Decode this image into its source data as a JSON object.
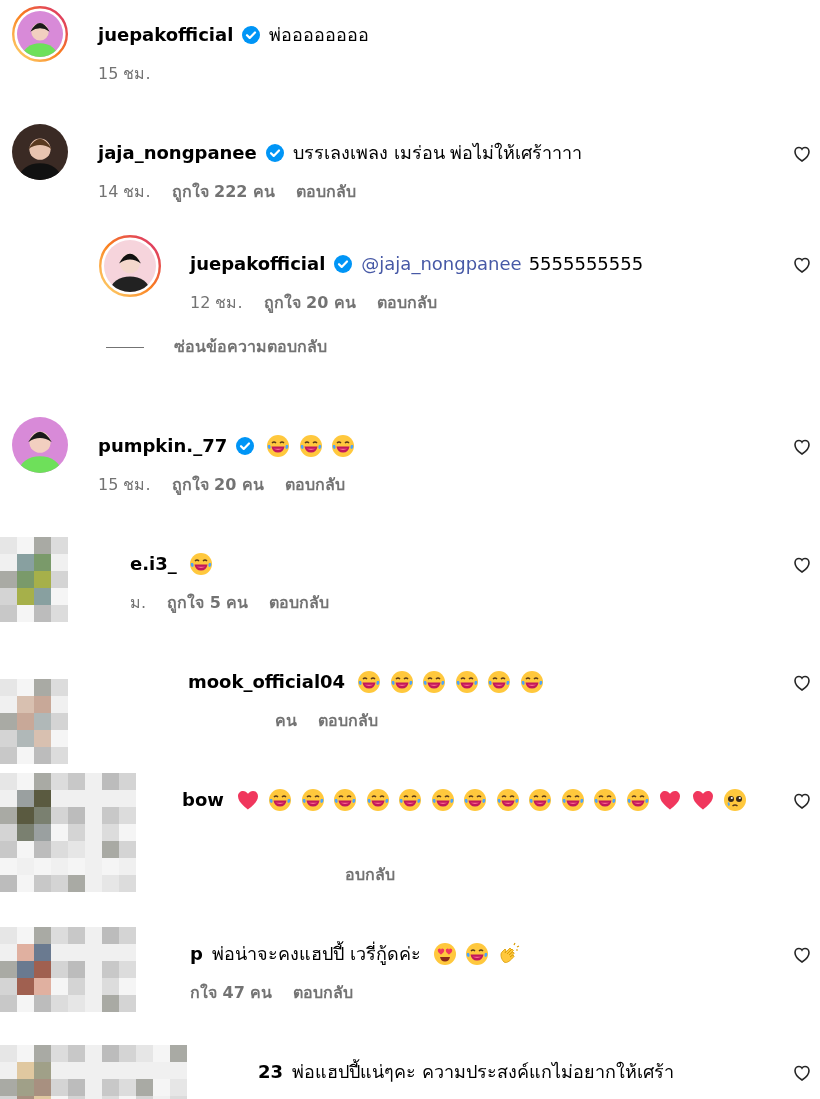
{
  "comments": [
    {
      "username": "juepakofficial",
      "verified": true,
      "has_story": true,
      "redacted": false,
      "text": "พ่ออออออออ",
      "meta": [
        {
          "kind": "time",
          "text": "15 ชม."
        }
      ],
      "like_button": false
    },
    {
      "username": "jaja_nongpanee",
      "verified": true,
      "has_story": false,
      "redacted": false,
      "text": "บรรเลงเพลง เมร่อน พ่อไม่ให้เศร้าาาา",
      "meta": [
        {
          "kind": "time",
          "text": "14 ชม."
        },
        {
          "kind": "likes",
          "text": "ถูกใจ 222 คน"
        },
        {
          "kind": "reply",
          "text": "ตอบกลับ"
        }
      ],
      "like_button": true,
      "children": [
        {
          "username": "juepakofficial",
          "verified": true,
          "has_story": true,
          "redacted": false,
          "mention": "@jaja_nongpanee",
          "text": "5555555555",
          "meta": [
            {
              "kind": "time",
              "text": "12 ชม."
            },
            {
              "kind": "likes",
              "text": "ถูกใจ 20 คน"
            },
            {
              "kind": "reply",
              "text": "ตอบกลับ"
            }
          ],
          "like_button": true
        }
      ],
      "hide_replies": "ซ่อนข้อความตอบกลับ"
    },
    {
      "username": "pumpkin._77",
      "verified": true,
      "has_story": false,
      "redacted": false,
      "emojis": [
        {
          "kind": "laugh"
        },
        {
          "kind": "laugh"
        },
        {
          "kind": "laugh"
        }
      ],
      "meta": [
        {
          "kind": "time",
          "text": "15 ชม."
        },
        {
          "kind": "likes",
          "text": "ถูกใจ 20 คน"
        },
        {
          "kind": "reply",
          "text": "ตอบกลับ"
        }
      ],
      "like_button": true
    },
    {
      "username": "e.i3_",
      "verified": false,
      "has_story": false,
      "redacted": true,
      "emojis": [
        {
          "kind": "laugh"
        }
      ],
      "meta": [
        {
          "kind": "time",
          "text": "ม."
        },
        {
          "kind": "likes",
          "text": "ถูกใจ 5 คน"
        },
        {
          "kind": "reply",
          "text": "ตอบกลับ"
        }
      ],
      "like_button": true
    },
    {
      "username": "mook_official04",
      "verified": false,
      "has_story": false,
      "redacted": true,
      "emojis": [
        {
          "kind": "laugh"
        },
        {
          "kind": "laugh"
        },
        {
          "kind": "laugh"
        },
        {
          "kind": "laugh"
        },
        {
          "kind": "laugh"
        },
        {
          "kind": "laugh"
        }
      ],
      "meta": [
        {
          "kind": "likes",
          "text": "คน"
        },
        {
          "kind": "reply",
          "text": "ตอบกลับ"
        }
      ],
      "like_button": true
    },
    {
      "username": "bow",
      "verified": false,
      "has_story": false,
      "redacted": true,
      "emojis": [
        {
          "kind": "heart"
        },
        {
          "kind": "laugh"
        },
        {
          "kind": "laugh"
        },
        {
          "kind": "laugh"
        },
        {
          "kind": "laugh"
        },
        {
          "kind": "laugh"
        },
        {
          "kind": "laugh"
        },
        {
          "kind": "laugh"
        },
        {
          "kind": "laugh"
        },
        {
          "kind": "laugh"
        },
        {
          "kind": "laugh"
        },
        {
          "kind": "laugh"
        },
        {
          "kind": "laugh"
        },
        {
          "kind": "heart"
        },
        {
          "kind": "heart"
        },
        {
          "kind": "pleading"
        }
      ],
      "meta": [
        {
          "kind": "reply",
          "text": "อบกลับ"
        }
      ],
      "like_button": true
    },
    {
      "username": "p",
      "verified": false,
      "has_story": false,
      "redacted": true,
      "text": "พ่อน่าจะคงแฮปปี้ เวรี่กู้ดค่ะ",
      "emojis": [
        {
          "kind": "heart_eyes"
        },
        {
          "kind": "laugh"
        },
        {
          "kind": "clap"
        }
      ],
      "meta": [
        {
          "kind": "likes",
          "text": "กใจ 47 คน"
        },
        {
          "kind": "reply",
          "text": "ตอบกลับ"
        }
      ],
      "like_button": true
    },
    {
      "username": "23",
      "verified": false,
      "has_story": false,
      "redacted": true,
      "text": "พ่อแฮปปี้แน่ๆคะ ความประสงค์แกไม่อยากให้เศร้า",
      "like_button": true
    }
  ]
}
